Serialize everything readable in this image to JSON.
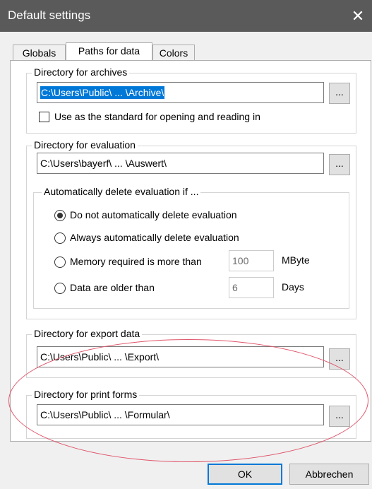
{
  "window": {
    "title": "Default settings",
    "close_glyph": "✕"
  },
  "tabs": [
    {
      "label": "Globals",
      "active": false
    },
    {
      "label": "Paths for data",
      "active": true
    },
    {
      "label": "Colors",
      "active": false
    }
  ],
  "archives": {
    "legend": "Directory for archives",
    "path": "C:\\Users\\Public\\ ... \\Archive\\",
    "browse": "...",
    "checkbox_label": "Use as the standard for opening and reading in",
    "checked": false
  },
  "evaluation": {
    "legend": "Directory for evaluation",
    "path": "C:\\Users\\bayerf\\ ... \\Auswert\\",
    "browse": "...",
    "auto_delete": {
      "legend": "Automatically delete evaluation if ...",
      "options": [
        {
          "label": "Do not automatically delete evaluation",
          "selected": true
        },
        {
          "label": "Always automatically delete evaluation",
          "selected": false
        },
        {
          "label": "Memory required is more than",
          "selected": false,
          "value": "100",
          "unit": "MByte"
        },
        {
          "label": "Data are older than",
          "selected": false,
          "value": "6",
          "unit": "Days"
        }
      ]
    }
  },
  "export": {
    "legend": "Directory for export data",
    "path": "C:\\Users\\Public\\ ... \\Export\\",
    "browse": "..."
  },
  "print_forms": {
    "legend": "Directory for print forms",
    "path": "C:\\Users\\Public\\ ... \\Formular\\",
    "browse": "..."
  },
  "footer": {
    "ok": "OK",
    "cancel": "Abbrechen"
  },
  "colors": {
    "accent": "#0078d7",
    "highlight_ellipse": "#e0566b",
    "titlebar": "#5a5a5a"
  }
}
